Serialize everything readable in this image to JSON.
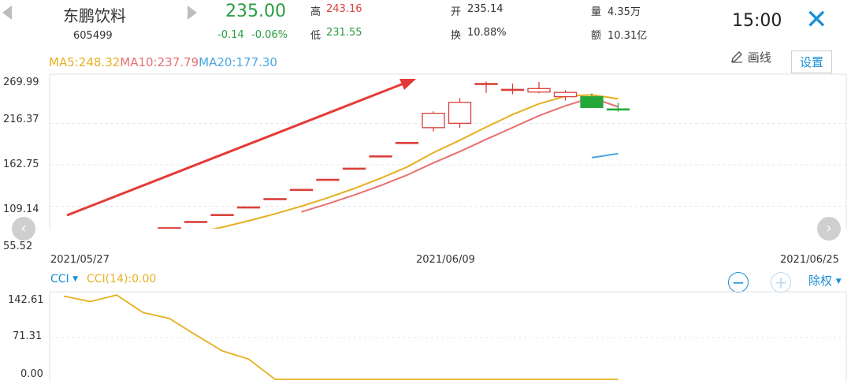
{
  "header": {
    "stock_name": "东鹏饮料",
    "stock_code": "605499",
    "price": "235.00",
    "change": "-0.14",
    "change_pct": "-0.06%",
    "high_label": "高",
    "high_value": "243.16",
    "low_label": "低",
    "low_value": "231.55",
    "open_label": "开",
    "open_value": "235.14",
    "turnover_label": "换",
    "turnover_value": "10.88%",
    "volume_label": "量",
    "volume_value": "4.35万",
    "amount_label": "额",
    "amount_value": "10.31亿",
    "time": "15:00",
    "close_icon": "close-icon",
    "prev_icon": "triangle-left-icon",
    "next_icon": "triangle-right-icon"
  },
  "toolbar": {
    "ma5": "MA5:248.32",
    "ma10": "MA10:237.79",
    "ma20": "MA20:177.30",
    "draw_label": "画线",
    "settings_label": "设置",
    "colors": {
      "ma5": "#e6b020",
      "ma10": "#e87070",
      "ma20": "#4aa8de",
      "up": "#d9403a",
      "down": "#25a83a"
    }
  },
  "kline": {
    "y_ticks": [
      "269.99",
      "216.37",
      "162.75",
      "109.14",
      "55.52"
    ],
    "x_ticks": [
      "2021/05/27",
      "2021/06/09",
      "2021/06/25"
    ],
    "prev_button": "‹",
    "next_button": "›"
  },
  "cci": {
    "indicator_label": "CCI",
    "value_label": "CCI(14):0.00",
    "y_ticks": [
      "142.61",
      "71.31",
      "0.00"
    ],
    "zoom_out": "−",
    "zoom_in": "+",
    "adjust_label": "除权"
  },
  "chart_data": [
    {
      "type": "candlestick",
      "title": "",
      "ylim": [
        55.52,
        269.99
      ],
      "x_ticks": [
        "2021/05/27",
        "2021/06/09",
        "2021/06/25"
      ],
      "candles": [
        {
          "o": 46,
          "c": 55.5,
          "h": 55.5,
          "l": 46
        },
        {
          "o": 61.1,
          "c": 61.1,
          "h": 61.1,
          "l": 61.1
        },
        {
          "o": 67.2,
          "c": 67.2,
          "h": 67.2,
          "l": 67.2
        },
        {
          "o": 73.9,
          "c": 73.9,
          "h": 73.9,
          "l": 73.9
        },
        {
          "o": 81.3,
          "c": 81.3,
          "h": 81.3,
          "l": 81.3
        },
        {
          "o": 89.4,
          "c": 89.4,
          "h": 89.4,
          "l": 89.4
        },
        {
          "o": 98.4,
          "c": 98.4,
          "h": 98.4,
          "l": 98.4
        },
        {
          "o": 108.2,
          "c": 108.2,
          "h": 108.2,
          "l": 108.2
        },
        {
          "o": 119.0,
          "c": 119.0,
          "h": 119.0,
          "l": 119.0
        },
        {
          "o": 130.9,
          "c": 130.9,
          "h": 130.9,
          "l": 130.9
        },
        {
          "o": 144.0,
          "c": 144.0,
          "h": 144.0,
          "l": 144.0
        },
        {
          "o": 158.4,
          "c": 158.4,
          "h": 158.4,
          "l": 158.4
        },
        {
          "o": 174.3,
          "c": 174.3,
          "h": 174.3,
          "l": 174.3
        },
        {
          "o": 191.7,
          "c": 191.7,
          "h": 191.7,
          "l": 191.7
        },
        {
          "o": 210.9,
          "c": 229.5,
          "h": 232.0,
          "l": 206.0
        },
        {
          "o": 216.5,
          "c": 243.7,
          "h": 249.0,
          "l": 210.5
        },
        {
          "o": 268.1,
          "c": 268.1,
          "h": 270.5,
          "l": 256.0
        },
        {
          "o": 260.5,
          "c": 260.5,
          "h": 268.0,
          "l": 254.0
        },
        {
          "o": 257.0,
          "c": 261.5,
          "h": 270.0,
          "l": 255.5
        },
        {
          "o": 251.0,
          "c": 256.5,
          "h": 259.5,
          "l": 246.0
        },
        {
          "o": 251.0,
          "c": 237.0,
          "h": 255.0,
          "l": 236.5
        },
        {
          "o": 235.1,
          "c": 235.0,
          "h": 243.2,
          "l": 231.6
        }
      ],
      "ma5": [
        null,
        null,
        null,
        null,
        67.5,
        74.6,
        82.0,
        90.2,
        99.2,
        109.1,
        120.1,
        132.1,
        145.3,
        159.9,
        178.5,
        194.6,
        211.7,
        227.9,
        241.7,
        251.6,
        253.3,
        248.3
      ],
      "ma10": [
        null,
        null,
        null,
        null,
        null,
        null,
        null,
        null,
        null,
        101.8,
        112.3,
        123.6,
        135.9,
        149.5,
        165.2,
        179.9,
        195.7,
        211.0,
        226.4,
        239.1,
        249.8,
        237.8
      ],
      "ma20": [
        null,
        null,
        null,
        null,
        null,
        null,
        null,
        null,
        null,
        null,
        null,
        null,
        null,
        null,
        null,
        null,
        null,
        null,
        null,
        null,
        172.0,
        177.3
      ]
    },
    {
      "type": "line",
      "title": "",
      "ylim": [
        0,
        142.61
      ],
      "series": [
        {
          "name": "CCI(14)",
          "values": [
            152,
            142,
            154,
            122,
            111,
            81,
            52,
            37,
            0,
            0,
            0,
            0,
            0,
            0,
            0,
            0,
            0,
            0,
            0,
            0,
            0,
            0
          ]
        }
      ]
    }
  ]
}
